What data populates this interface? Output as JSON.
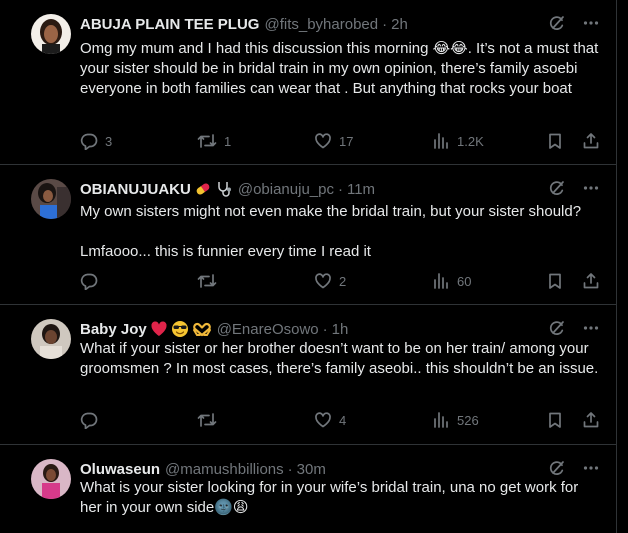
{
  "tweets": [
    {
      "name": "ABUJA PLAIN TEE PLUG",
      "handle": "@fits_byharobed",
      "time": "2h",
      "text": "Omg my mum and I had this discussion this morning 😂😂. It’s not a must that your sister should be in bridal train in my own opinion, there’s family asoebi everyone in both families can wear that . But anything that rocks your boat",
      "replies": "3",
      "reposts": "1",
      "likes": "17",
      "views": "1.2K"
    },
    {
      "name": "OBIANUJUAKU",
      "name_emojis": [
        "pill-emoji",
        "stethoscope-emoji"
      ],
      "handle": "@obianuju_pc",
      "time": "11m",
      "text": "My own sisters might not even make the bridal train, but your sister should?\n\nLmfaooo... this is funnier every time I read it",
      "replies": "",
      "reposts": "",
      "likes": "2",
      "views": "60"
    },
    {
      "name": "Baby Joy",
      "name_emojis": [
        "red-heart-emoji",
        "sunglasses-emoji",
        "heart-hands-emoji"
      ],
      "handle": "@EnareOsowo",
      "time": "1h",
      "text": "What if your sister or her brother doesn’t want to be on her train/ among your groomsmen ? In most cases, there’s family aseobi.. this shouldn’t be an issue.",
      "replies": "",
      "reposts": "",
      "likes": "4",
      "views": "526"
    },
    {
      "name": "Oluwaseun",
      "handle": "@mamushbillions",
      "time": "30m",
      "text": "What is your sister looking for in your wife’s bridal train, una no get work for her in your own side🌚😩"
    }
  ],
  "separator": "·",
  "colors": {
    "background": "#000000",
    "text": "#e7e9ea",
    "muted": "#71767b",
    "border": "#2f3336"
  },
  "icons": [
    "grok-icon",
    "more-icon",
    "reply-icon",
    "repost-icon",
    "like-icon",
    "views-icon",
    "bookmark-icon",
    "share-icon"
  ]
}
